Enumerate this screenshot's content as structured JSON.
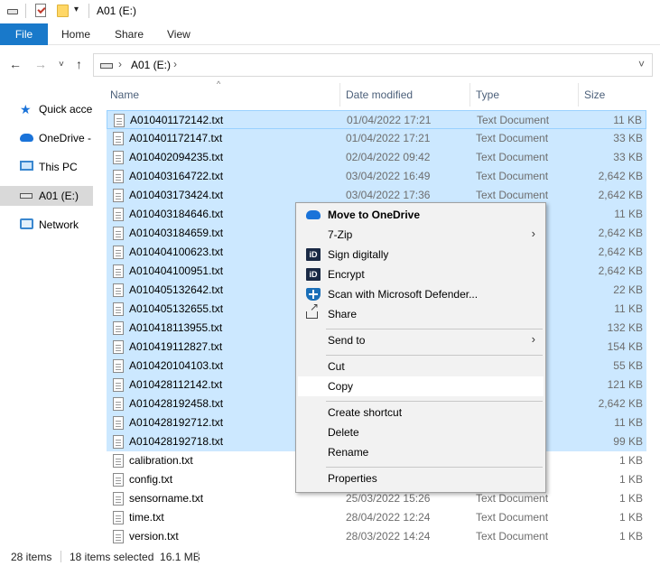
{
  "window": {
    "title": "A01 (E:)"
  },
  "ribbon": {
    "tabs": [
      "File",
      "Home",
      "Share",
      "View"
    ]
  },
  "address": {
    "path": "A01 (E:)"
  },
  "sidebar": {
    "items": [
      {
        "label": "Quick acce",
        "icon": "star-icon"
      },
      {
        "label": "OneDrive -",
        "icon": "cloud-icon"
      },
      {
        "label": "This PC",
        "icon": "computer-icon"
      },
      {
        "label": "A01 (E:)",
        "icon": "drive-icon"
      },
      {
        "label": "Network",
        "icon": "network-icon"
      }
    ]
  },
  "columns": {
    "name": "Name",
    "date": "Date modified",
    "type": "Type",
    "size": "Size"
  },
  "files": [
    {
      "name": "A010401172142.txt",
      "date": "01/04/2022 17:21",
      "type": "Text Document",
      "size": "11 KB",
      "selected": true
    },
    {
      "name": "A010401172147.txt",
      "date": "01/04/2022 17:21",
      "type": "Text Document",
      "size": "33 KB",
      "selected": true
    },
    {
      "name": "A010402094235.txt",
      "date": "02/04/2022 09:42",
      "type": "Text Document",
      "size": "33 KB",
      "selected": true
    },
    {
      "name": "A010403164722.txt",
      "date": "03/04/2022 16:49",
      "type": "Text Document",
      "size": "2,642 KB",
      "selected": true
    },
    {
      "name": "A010403173424.txt",
      "date": "03/04/2022 17:36",
      "type": "Text Document",
      "size": "2,642 KB",
      "selected": true
    },
    {
      "name": "A010403184646.txt",
      "date": "",
      "type": "",
      "size": "11 KB",
      "selected": true
    },
    {
      "name": "A010403184659.txt",
      "date": "",
      "type": "",
      "size": "2,642 KB",
      "selected": true
    },
    {
      "name": "A010404100623.txt",
      "date": "",
      "type": "",
      "size": "2,642 KB",
      "selected": true
    },
    {
      "name": "A010404100951.txt",
      "date": "",
      "type": "",
      "size": "2,642 KB",
      "selected": true
    },
    {
      "name": "A010405132642.txt",
      "date": "",
      "type": "",
      "size": "22 KB",
      "selected": true
    },
    {
      "name": "A010405132655.txt",
      "date": "",
      "type": "",
      "size": "11 KB",
      "selected": true
    },
    {
      "name": "A010418113955.txt",
      "date": "",
      "type": "",
      "size": "132 KB",
      "selected": true
    },
    {
      "name": "A010419112827.txt",
      "date": "",
      "type": "",
      "size": "154 KB",
      "selected": true
    },
    {
      "name": "A010420104103.txt",
      "date": "",
      "type": "",
      "size": "55 KB",
      "selected": true
    },
    {
      "name": "A010428112142.txt",
      "date": "",
      "type": "",
      "size": "121 KB",
      "selected": true
    },
    {
      "name": "A010428192458.txt",
      "date": "",
      "type": "",
      "size": "2,642 KB",
      "selected": true
    },
    {
      "name": "A010428192712.txt",
      "date": "",
      "type": "",
      "size": "11 KB",
      "selected": true
    },
    {
      "name": "A010428192718.txt",
      "date": "",
      "type": "",
      "size": "99 KB",
      "selected": true
    },
    {
      "name": "calibration.txt",
      "date": "",
      "type": "",
      "size": "1 KB",
      "selected": false
    },
    {
      "name": "config.txt",
      "date": "",
      "type": "",
      "size": "1 KB",
      "selected": false
    },
    {
      "name": "sensorname.txt",
      "date": "25/03/2022 15:26",
      "type": "Text Document",
      "size": "1 KB",
      "selected": false
    },
    {
      "name": "time.txt",
      "date": "28/04/2022 12:24",
      "type": "Text Document",
      "size": "1 KB",
      "selected": false
    },
    {
      "name": "version.txt",
      "date": "28/03/2022 14:24",
      "type": "Text Document",
      "size": "1 KB",
      "selected": false
    }
  ],
  "status": {
    "items": "28 items",
    "selected": "18 items selected  16.1 MB"
  },
  "context_menu": {
    "move_onedrive": "Move to OneDrive",
    "zip": "7-Zip",
    "sign": "Sign digitally",
    "encrypt": "Encrypt",
    "scan": "Scan with Microsoft Defender...",
    "share": "Share",
    "send_to": "Send to",
    "cut": "Cut",
    "copy": "Copy",
    "create_shortcut": "Create shortcut",
    "delete": "Delete",
    "rename": "Rename",
    "properties": "Properties",
    "id_glyph": "iD"
  }
}
